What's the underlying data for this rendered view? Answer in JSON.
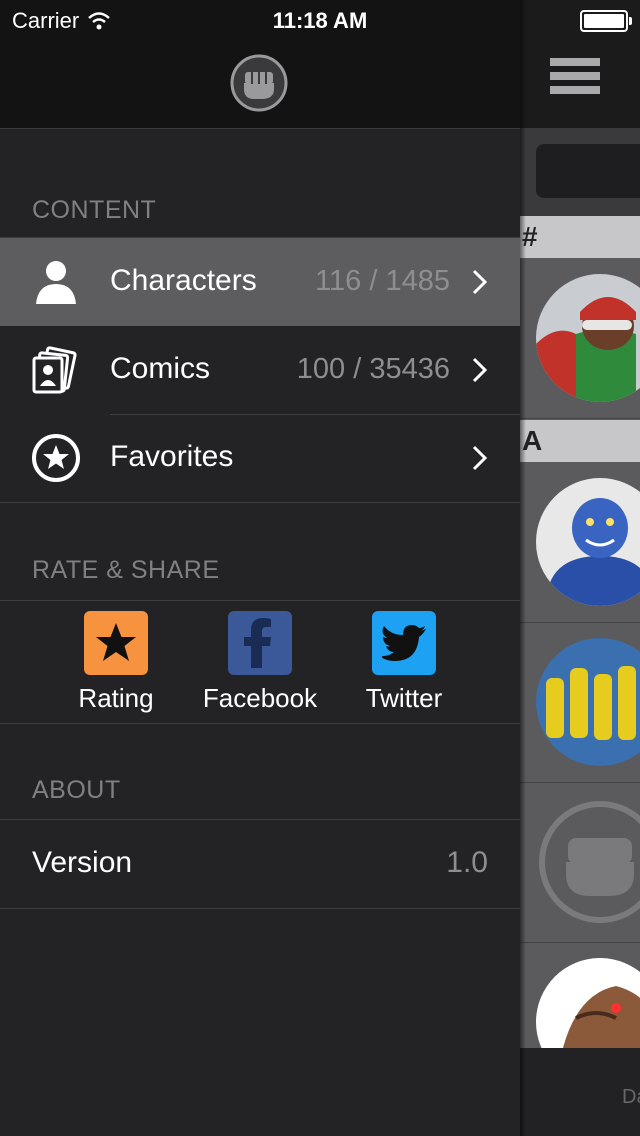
{
  "status_bar": {
    "carrier": "Carrier",
    "time": "11:18 AM"
  },
  "menu": {
    "sections": {
      "content": "CONTENT",
      "rate_share": "RATE & SHARE",
      "about": "ABOUT"
    },
    "items": [
      {
        "label": "Characters",
        "count": "116 / 1485",
        "icon": "person-icon",
        "selected": true
      },
      {
        "label": "Comics",
        "count": "100 / 35436",
        "icon": "comics-icon",
        "selected": false
      },
      {
        "label": "Favorites",
        "count": "",
        "icon": "star-icon",
        "selected": false
      }
    ],
    "share": [
      {
        "label": "Rating",
        "icon": "star-icon",
        "color": "#f7933e"
      },
      {
        "label": "Facebook",
        "icon": "facebook-icon",
        "color": "#3b5998"
      },
      {
        "label": "Twitter",
        "icon": "twitter-icon",
        "color": "#1da1f2"
      }
    ],
    "version": {
      "label": "Version",
      "value": "1.0"
    }
  },
  "list_panel": {
    "section_headers": [
      "#",
      "A"
    ],
    "footer_text": "Da"
  }
}
